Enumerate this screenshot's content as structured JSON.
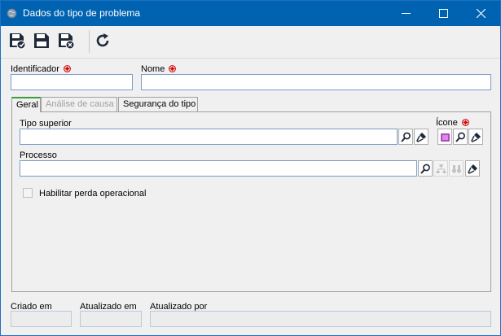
{
  "window": {
    "title": "Dados do tipo de problema",
    "accent_color": "#0063b1",
    "controls": [
      "minimize-icon",
      "maximize-icon",
      "close-icon"
    ]
  },
  "toolbar": {
    "buttons": [
      "save-new-icon",
      "save-icon",
      "save-close-icon",
      "refresh-icon"
    ]
  },
  "form": {
    "identificador_label": "Identificador",
    "identificador_value": "",
    "nome_label": "Nome",
    "nome_value": ""
  },
  "tabs": [
    {
      "label": "Geral",
      "state": "active"
    },
    {
      "label": "Análise de causa",
      "state": "disabled"
    },
    {
      "label": "Segurança do tipo",
      "state": "normal"
    }
  ],
  "geral": {
    "tipo_superior_label": "Tipo superior",
    "tipo_superior_value": "",
    "icone_label": "Ícone",
    "processo_label": "Processo",
    "processo_value": "",
    "habilitar_label": "Habilitar perda operacional",
    "habilitar_checked": false
  },
  "footer": {
    "criado_em_label": "Criado em",
    "criado_em_value": "",
    "atualizado_em_label": "Atualizado em",
    "atualizado_em_value": "",
    "atualizado_por_label": "Atualizado por",
    "atualizado_por_value": ""
  }
}
